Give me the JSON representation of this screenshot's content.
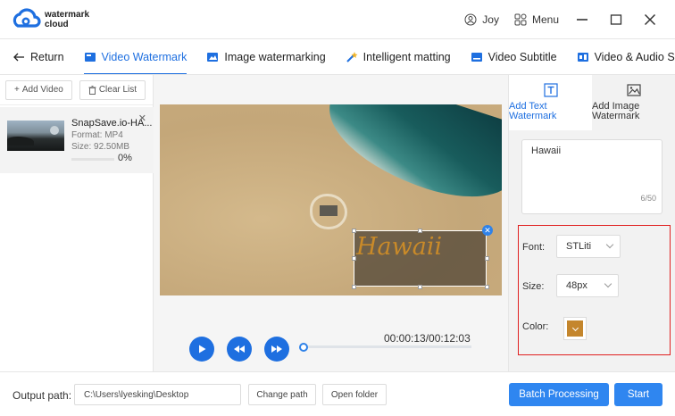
{
  "app": {
    "logo_line1": "watermark",
    "logo_line2": "cloud",
    "user_label": "Joy",
    "menu_label": "Menu"
  },
  "nav": {
    "return_label": "Return",
    "tabs": [
      {
        "label": "Video Watermark",
        "active": true
      },
      {
        "label": "Image watermarking",
        "active": false
      },
      {
        "label": "Intelligent matting",
        "active": false
      },
      {
        "label": "Video Subtitle",
        "active": false
      },
      {
        "label": "Video & Audio Sepa",
        "active": false
      }
    ]
  },
  "file_list": {
    "add_video_label": "Add Video",
    "clear_list_label": "Clear List",
    "items": [
      {
        "name": "SnapSave.io-HA...",
        "format": "Format:  MP4",
        "size": "Size:  92.50MB",
        "progress_text": "0%",
        "progress": 0
      }
    ]
  },
  "player": {
    "time_text": "00:00:13/00:12:03",
    "watermark_text": "Hawaii",
    "watermark_color": "#c98a29"
  },
  "watermark_panel": {
    "tab_text_label_1": "Add Text",
    "tab_text_label_2": "Watermark",
    "tab_image_label_1": "Add Image",
    "tab_image_label_2": "Watermark",
    "text_value": "Hawaii",
    "char_count": "6/50",
    "font_label": "Font:",
    "font_value": "STLiti",
    "size_label": "Size:",
    "size_value": "48px",
    "color_label": "Color:",
    "color_value": "#c4862d"
  },
  "bottom": {
    "output_path_label": "Output path:",
    "output_path_value": "C:\\Users\\lyesking\\Desktop",
    "change_path_label": "Change path",
    "open_folder_label": "Open folder",
    "batch_label": "Batch Processing",
    "start_label": "Start"
  },
  "colors": {
    "accent": "#1e6fe0",
    "primary_button": "#2f86f0",
    "highlight_border": "#e02020"
  }
}
